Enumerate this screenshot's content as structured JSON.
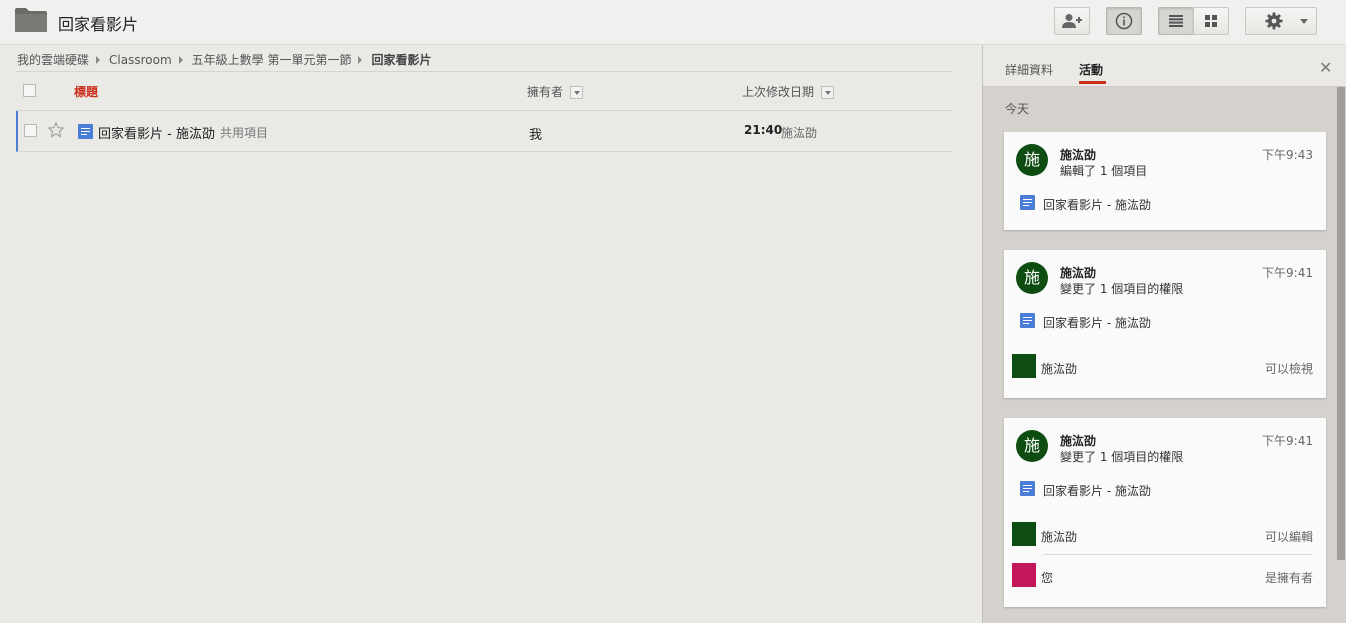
{
  "header": {
    "title": "回家看影片",
    "buttons": [
      "add-person",
      "details",
      "list-view",
      "grid-view",
      "settings"
    ]
  },
  "breadcrumb": {
    "items": [
      "我的雲端硬碟",
      "Classroom",
      "五年級上數學 第一單元第一節"
    ],
    "current": "回家看影片"
  },
  "list": {
    "columns": {
      "title": "標題",
      "owner": "擁有者",
      "modified": "上次修改日期"
    },
    "rows": [
      {
        "title": "回家看影片 - 施汯劭",
        "shared": "共用項目",
        "owner": "我",
        "time": "21:40",
        "modified_by": "施汯劭"
      }
    ]
  },
  "panel": {
    "tabs": [
      "詳細資料",
      "活動"
    ],
    "active_tab": "活動",
    "day_label": "今天",
    "cards": [
      {
        "avatar": "施",
        "name": "施汯劭",
        "action": "編輯了 1 個項目",
        "time": "下午9:43",
        "file": "回家看影片 - 施汯劭",
        "permissions": []
      },
      {
        "avatar": "施",
        "name": "施汯劭",
        "action": "變更了 1 個項目的權限",
        "time": "下午9:41",
        "file": "回家看影片 - 施汯劭",
        "permissions": [
          {
            "name": "施汯劭",
            "role": "可以檢視",
            "color": "#0e4d11"
          }
        ]
      },
      {
        "avatar": "施",
        "name": "施汯劭",
        "action": "變更了 1 個項目的權限",
        "time": "下午9:41",
        "file": "回家看影片 - 施汯劭",
        "permissions": [
          {
            "name": "施汯劭",
            "role": "可以編輯",
            "color": "#0e4d11"
          },
          {
            "name": "您",
            "role": "是擁有者",
            "color": "#c2185b"
          }
        ]
      }
    ]
  },
  "colors": {
    "accent_red": "#c9311f",
    "doc_blue": "#4a7ed6",
    "avatar_green": "#0e4d11",
    "owner_pink": "#c2185b"
  }
}
